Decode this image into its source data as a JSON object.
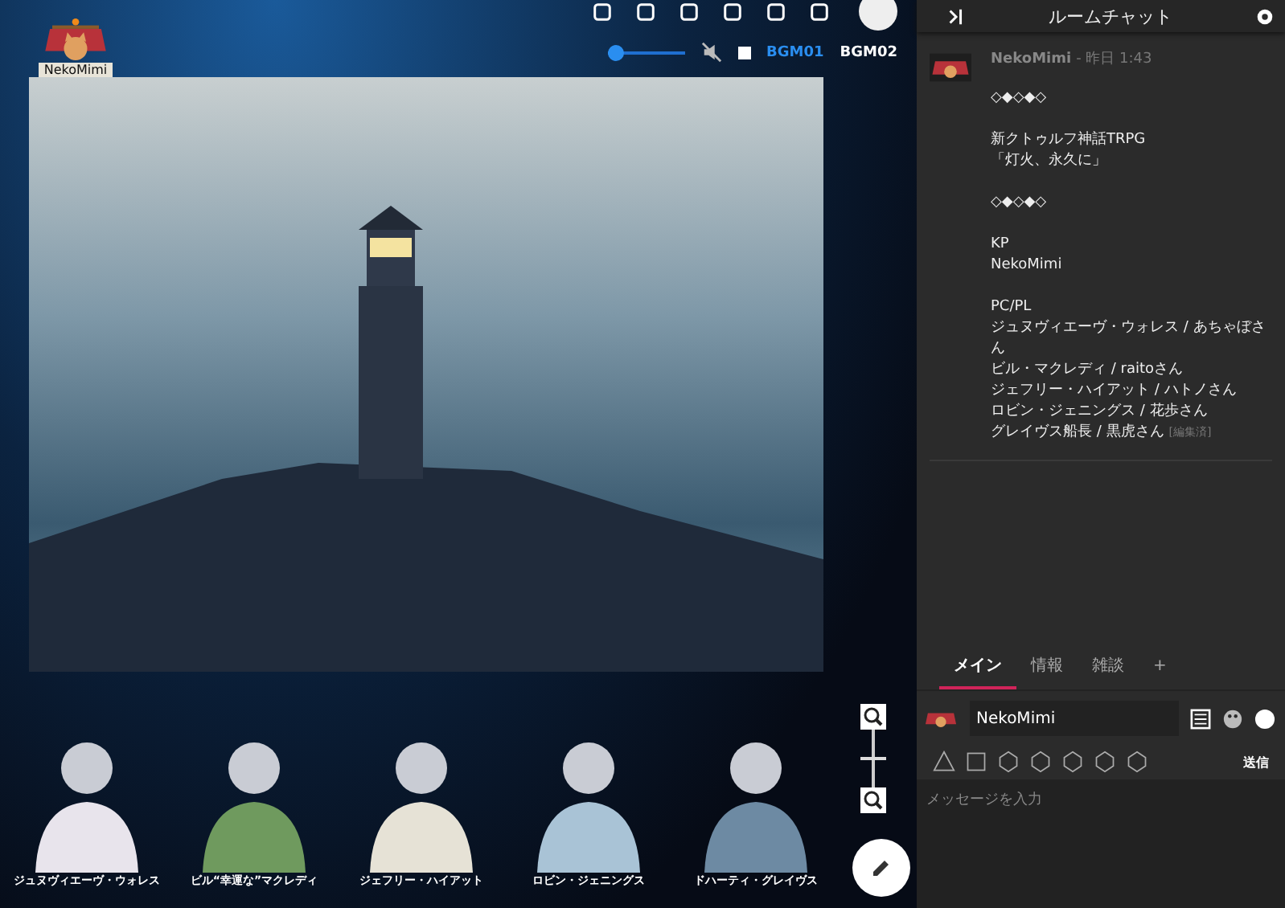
{
  "user_badge": {
    "name": "NekoMimi"
  },
  "zoom": {
    "level": 0.5
  },
  "bgm": {
    "level": 0.12,
    "muted": true,
    "tracks": [
      {
        "label": "BGM01",
        "selected": true
      },
      {
        "label": "BGM02",
        "selected": false
      }
    ]
  },
  "characters": [
    {
      "name": "ジュヌヴィエーヴ・ウォレス",
      "color": "#e8e4ec"
    },
    {
      "name": "ビル“幸運な”マクレディ",
      "color": "#6f9a5e"
    },
    {
      "name": "ジェフリー・ハイアット",
      "color": "#e6e2d6"
    },
    {
      "name": "ロビン・ジェニングス",
      "color": "#a9c3d6"
    },
    {
      "name": "ドハーティ・グレイヴス",
      "color": "#6d8aa3"
    }
  ],
  "chat": {
    "title": "ルームチャット",
    "messages": [
      {
        "author": "NekoMimi",
        "time": "- 昨日 1:43",
        "edited": "[編集済]",
        "paragraphs": [
          [
            "◇◆◇◆◇"
          ],
          [
            "新クトゥルフ神話TRPG",
            "「灯火、永久に」"
          ],
          [
            "◇◆◇◆◇"
          ],
          [
            "KP",
            "NekoMimi"
          ],
          [
            "PC/PL",
            "ジュヌヴィエーヴ・ウォレス / あちゃぼさん",
            "ビル・マクレディ / raitoさん",
            "ジェフリー・ハイアット / ハトノさん",
            "ロビン・ジェニングス / 花歩さん",
            "グレイヴス船長 / 黒虎さん"
          ]
        ]
      }
    ],
    "tabs": [
      {
        "label": "メイン",
        "selected": true
      },
      {
        "label": "情報",
        "selected": false
      },
      {
        "label": "雑談",
        "selected": false
      },
      {
        "label": "+",
        "selected": false
      }
    ],
    "composer": {
      "name": "NekoMimi",
      "send": "送信",
      "placeholder": "メッセージを入力"
    }
  }
}
